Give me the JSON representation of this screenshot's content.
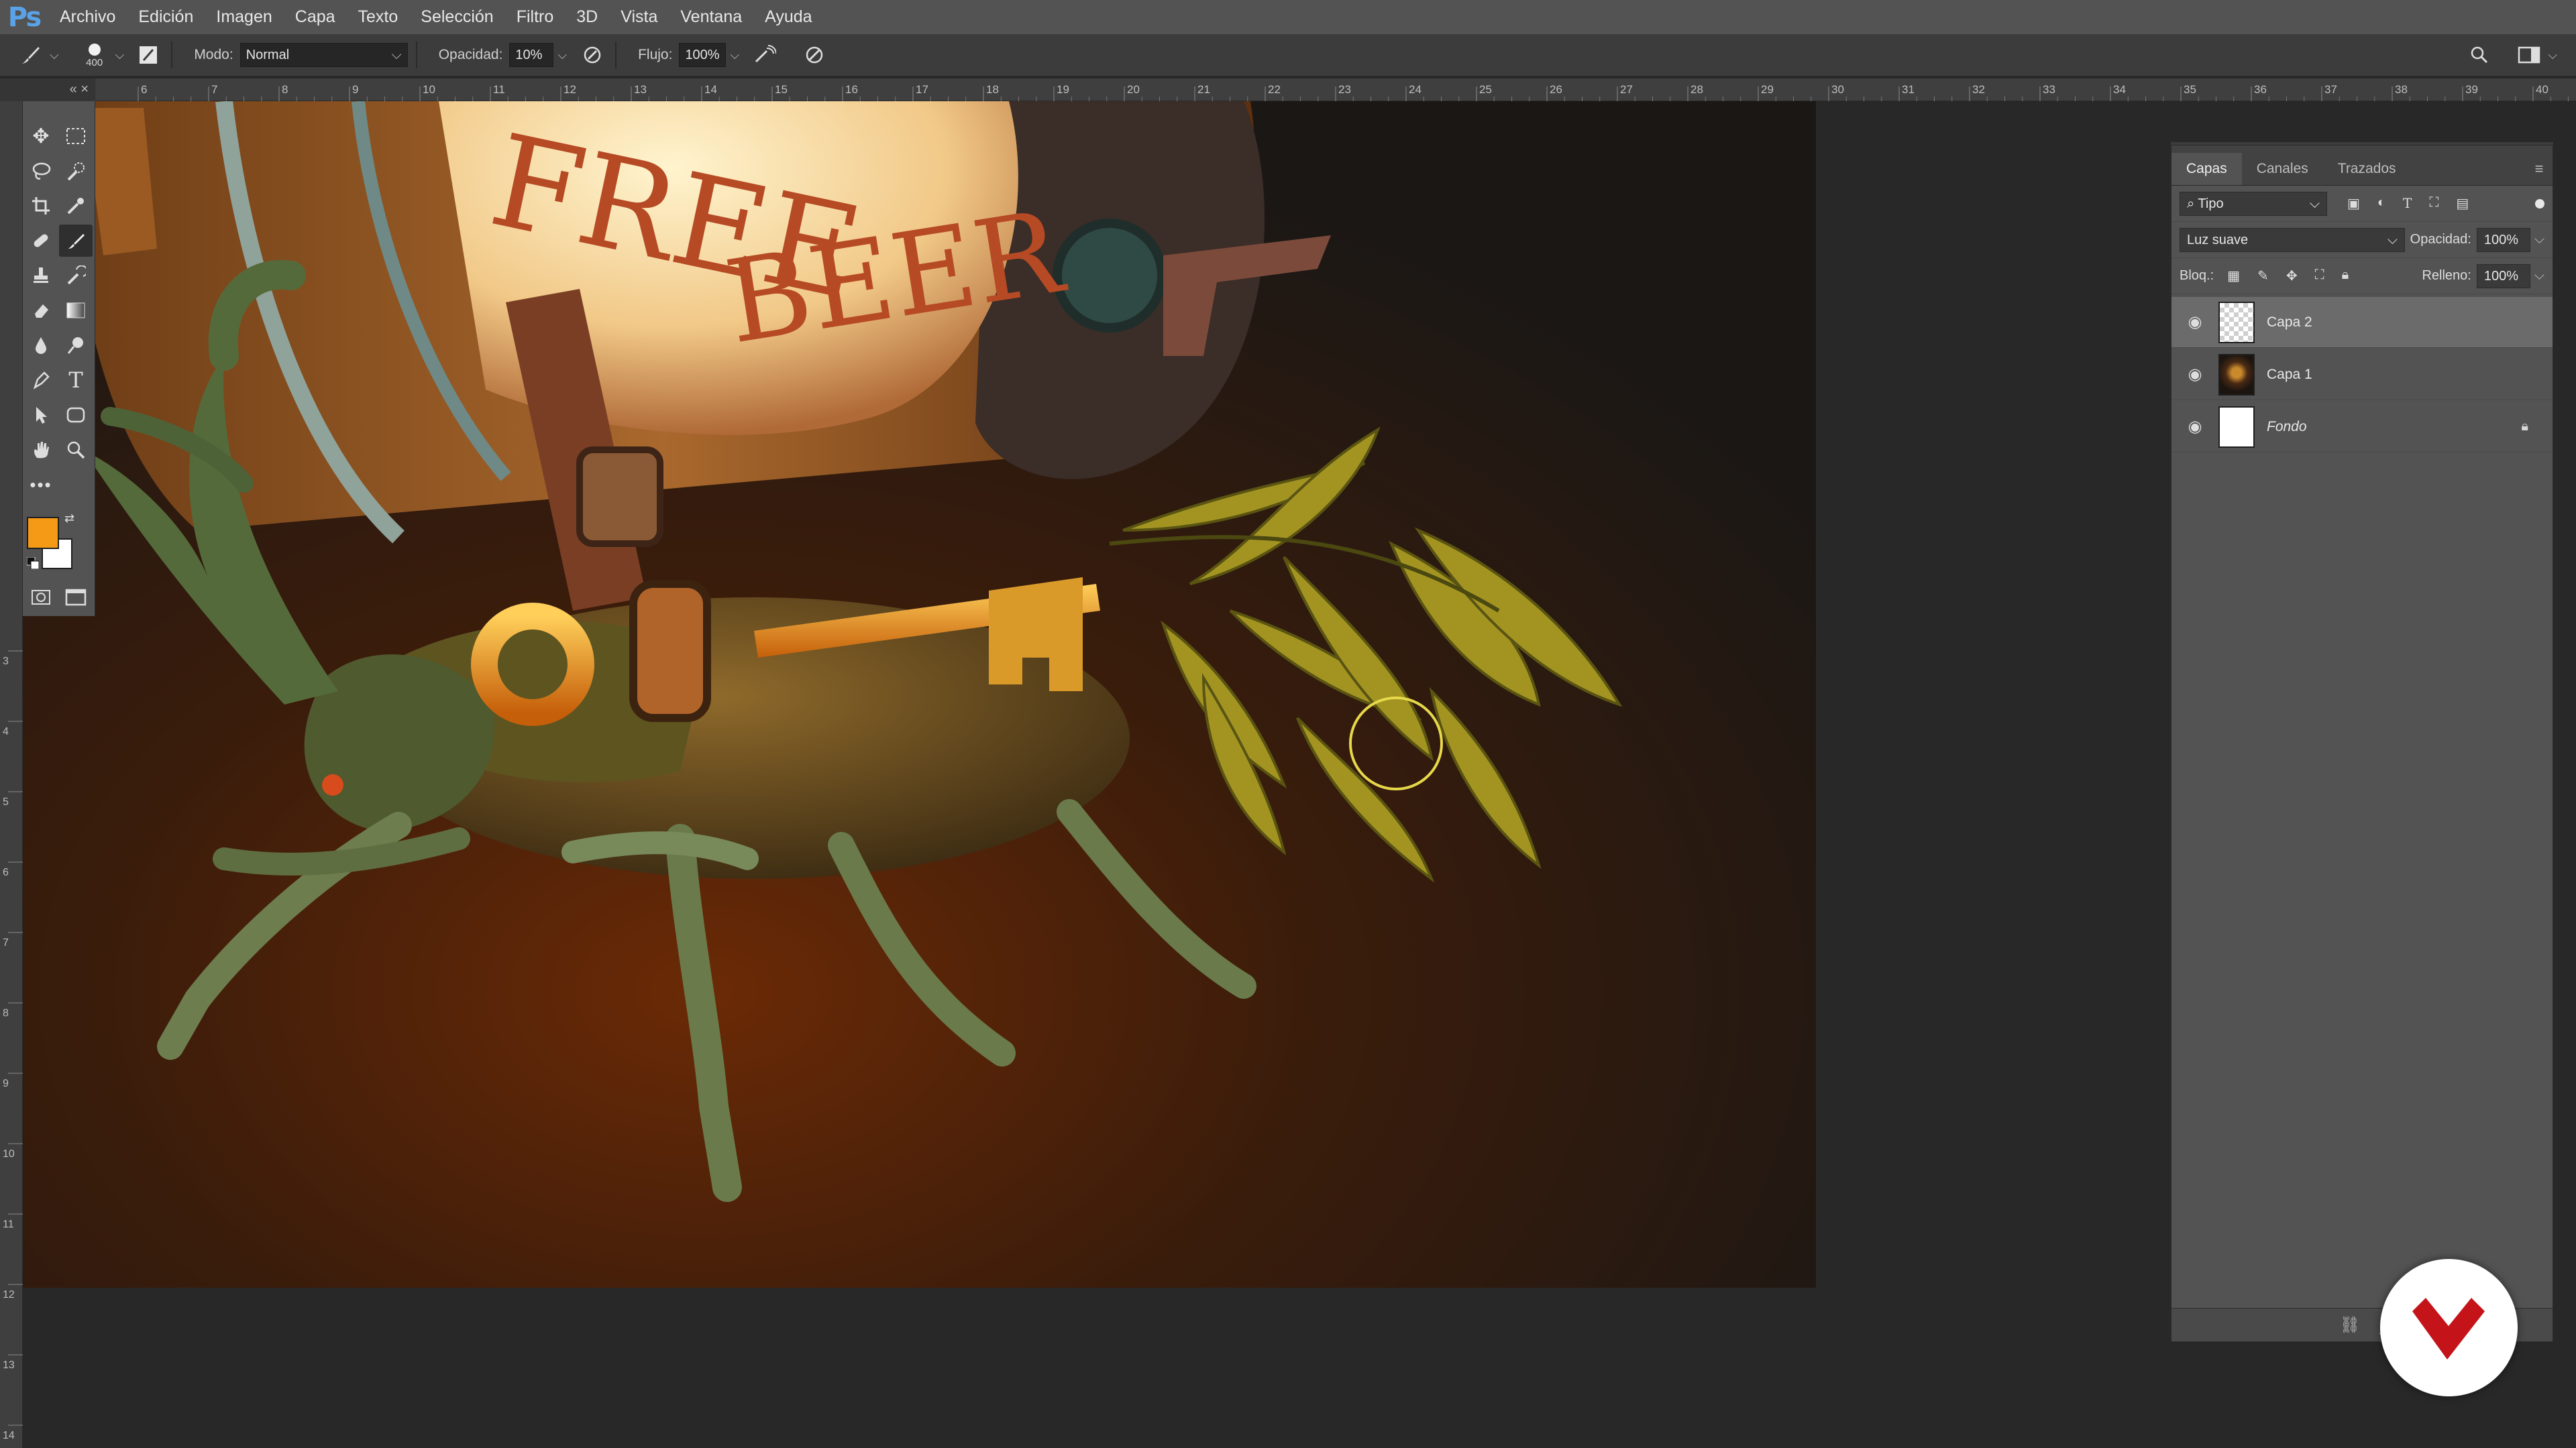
{
  "app": {
    "logo": "Ps",
    "menu": [
      "Archivo",
      "Edición",
      "Imagen",
      "Capa",
      "Texto",
      "Selección",
      "Filtro",
      "3D",
      "Vista",
      "Ventana",
      "Ayuda"
    ]
  },
  "options": {
    "brush_size": "400",
    "mode_label": "Modo:",
    "mode_value": "Normal",
    "opacity_label": "Opacidad:",
    "opacity_value": "10%",
    "flow_label": "Flujo:",
    "flow_value": "100%",
    "icons": [
      "brush-tool-icon",
      "brush-preset-icon",
      "toggle-brush-panel-icon",
      "pressure-opacity-icon",
      "airbrush-icon",
      "pressure-size-icon",
      "search-icon",
      "workspace-icon"
    ]
  },
  "panels_collapse": "«  ×",
  "rulers": {
    "horizontal_labels": [
      "6",
      "7",
      "8",
      "9",
      "10",
      "11",
      "12",
      "13",
      "14",
      "15",
      "16",
      "17",
      "18",
      "19",
      "20",
      "21",
      "22",
      "23",
      "24",
      "25",
      "26",
      "27",
      "28",
      "29",
      "30",
      "31",
      "32",
      "33",
      "34",
      "35",
      "36",
      "37",
      "38",
      "39",
      "40"
    ],
    "vertical_labels": [
      "3",
      "4",
      "5",
      "6",
      "7",
      "8",
      "9",
      "10",
      "11",
      "12",
      "13",
      "14"
    ]
  },
  "tools": {
    "foreground_color": "#f59a16",
    "background_color": "#ffffff",
    "items": [
      "move-tool-icon",
      "marquee-tool-icon",
      "lasso-tool-icon",
      "quick-select-tool-icon",
      "crop-tool-icon",
      "eyedropper-tool-icon",
      "healing-tool-icon",
      "brush-tool-icon",
      "stamp-tool-icon",
      "history-brush-tool-icon",
      "eraser-tool-icon",
      "gradient-tool-icon",
      "blur-tool-icon",
      "dodge-tool-icon",
      "pen-tool-icon",
      "type-tool-icon",
      "path-select-tool-icon",
      "shape-tool-icon",
      "hand-tool-icon",
      "zoom-tool-icon",
      "more-tools-icon",
      "quickmask-icon",
      "screen-mode-icon"
    ]
  },
  "artwork": {
    "banner_line1": "FREE",
    "banner_line2": "BEER"
  },
  "layers_panel": {
    "tabs": [
      "Capas",
      "Canales",
      "Trazados"
    ],
    "filter_label": "Tipo",
    "blend_mode": "Luz suave",
    "opacity_label": "Opacidad:",
    "opacity_value": "100%",
    "lock_label": "Bloq.:",
    "fill_label": "Relleno:",
    "fill_value": "100%",
    "layers": [
      {
        "name": "Capa 2",
        "selected": true
      },
      {
        "name": "Capa 1",
        "selected": false
      },
      {
        "name": "Fondo",
        "selected": false,
        "locked": true
      }
    ]
  },
  "watermark": "logo"
}
